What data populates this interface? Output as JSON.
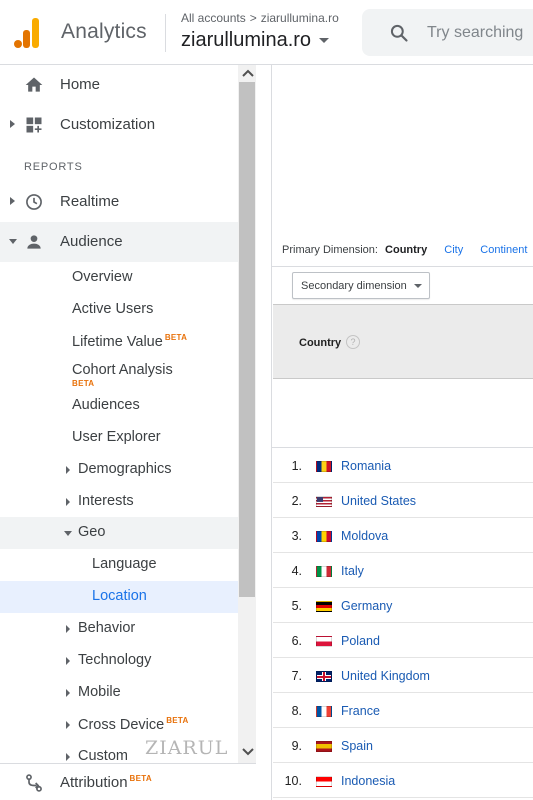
{
  "header": {
    "app_title": "Analytics",
    "breadcrumb_account_label": "All accounts",
    "breadcrumb_separator": ">",
    "breadcrumb_property": "ziarullumina.ro",
    "property_name": "ziarullumina.ro",
    "search_placeholder": "Try searching",
    "logo_colors": [
      "#e37400",
      "#f9ab00"
    ]
  },
  "sidebar": {
    "top_items": [
      {
        "label": "Home",
        "icon": "home-icon"
      },
      {
        "label": "Customization",
        "icon": "dashboard-plus-icon"
      }
    ],
    "section_label": "REPORTS",
    "report_items": [
      {
        "label": "Realtime",
        "icon": "clock-icon",
        "expanded": false
      },
      {
        "label": "Audience",
        "icon": "person-icon",
        "expanded": true
      }
    ],
    "audience_children": [
      {
        "label": "Overview"
      },
      {
        "label": "Active Users"
      },
      {
        "label": "Lifetime Value",
        "badge": "BETA"
      },
      {
        "label": "Cohort Analysis",
        "badge": "BETA"
      },
      {
        "label": "Audiences"
      },
      {
        "label": "User Explorer"
      },
      {
        "label": "Demographics",
        "expandable": true
      },
      {
        "label": "Interests",
        "expandable": true
      },
      {
        "label": "Geo",
        "expandable": true,
        "expanded": true
      }
    ],
    "geo_children": [
      {
        "label": "Language"
      },
      {
        "label": "Location",
        "selected": true
      }
    ],
    "more_children": [
      {
        "label": "Behavior"
      },
      {
        "label": "Technology"
      },
      {
        "label": "Mobile"
      },
      {
        "label": "Cross Device",
        "badge": "BETA"
      },
      {
        "label": "Custom"
      }
    ],
    "bottom_item": {
      "label": "Attribution",
      "badge": "BETA",
      "icon": "attribution-icon"
    },
    "watermark": "ZIARUL"
  },
  "main": {
    "primary_dimension_label": "Primary Dimension:",
    "dimensions": [
      "Country",
      "City",
      "Continent"
    ],
    "active_dimension": "Country",
    "secondary_dimension_label": "Secondary dimension",
    "table_header": "Country",
    "help_glyph": "?",
    "rows": [
      {
        "rank": "1.",
        "country": "Romania",
        "flag": [
          "#002b7f",
          "#fcd116",
          "#ce1126"
        ],
        "flag_dir": "v"
      },
      {
        "rank": "2.",
        "country": "United States",
        "flag": [
          "#b22234",
          "#ffffff",
          "#3c3b6e"
        ],
        "flag_dir": "us"
      },
      {
        "rank": "3.",
        "country": "Moldova",
        "flag": [
          "#0046ae",
          "#ffd200",
          "#cc092f"
        ],
        "flag_dir": "v"
      },
      {
        "rank": "4.",
        "country": "Italy",
        "flag": [
          "#009246",
          "#ffffff",
          "#ce2b37"
        ],
        "flag_dir": "v"
      },
      {
        "rank": "5.",
        "country": "Germany",
        "flag": [
          "#000000",
          "#dd0000",
          "#ffce00"
        ],
        "flag_dir": "h"
      },
      {
        "rank": "6.",
        "country": "Poland",
        "flag": [
          "#ffffff",
          "#dc143c"
        ],
        "flag_dir": "h"
      },
      {
        "rank": "7.",
        "country": "United Kingdom",
        "flag": [
          "#012169",
          "#ffffff",
          "#c8102e"
        ],
        "flag_dir": "uk"
      },
      {
        "rank": "8.",
        "country": "France",
        "flag": [
          "#0055a4",
          "#ffffff",
          "#ef4135"
        ],
        "flag_dir": "v"
      },
      {
        "rank": "9.",
        "country": "Spain",
        "flag": [
          "#aa151b",
          "#f1bf00",
          "#aa151b"
        ],
        "flag_dir": "es"
      },
      {
        "rank": "10.",
        "country": "Indonesia",
        "flag": [
          "#ff0000",
          "#ffffff"
        ],
        "flag_dir": "h"
      }
    ]
  }
}
